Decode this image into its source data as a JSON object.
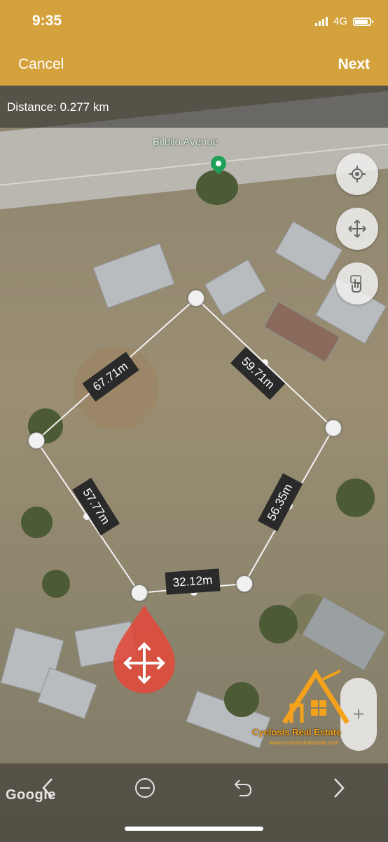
{
  "status_bar": {
    "time": "9:35",
    "network": "4G"
  },
  "header": {
    "cancel_label": "Cancel",
    "next_label": "Next"
  },
  "distance": {
    "text": "Distance: 0.277 km"
  },
  "map": {
    "street_name": "Bilbilo Avenue",
    "attribution": "Google"
  },
  "segments": [
    {
      "label": "67.71m"
    },
    {
      "label": "59.71m"
    },
    {
      "label": "56.35m"
    },
    {
      "label": "32.12m"
    },
    {
      "label": "57.77m"
    }
  ],
  "controls": {
    "locate_icon": "crosshair-icon",
    "pan_icon": "move-arrows-icon",
    "touch_icon": "hand-pointer-icon",
    "zoom_in": "+",
    "minus_icon": "minus-circle-icon",
    "undo_icon": "undo-icon",
    "back_icon": "chevron-left-icon",
    "forward_icon": "chevron-right-icon"
  },
  "watermark": {
    "name": "Cyclosis Real Estate",
    "url": "www.cyclosisrealestate.com"
  },
  "colors": {
    "header": "#d4a23c",
    "drag_handle": "#e04a3c",
    "label_bg": "#2a2a2a",
    "pin": "#1fa05a"
  }
}
